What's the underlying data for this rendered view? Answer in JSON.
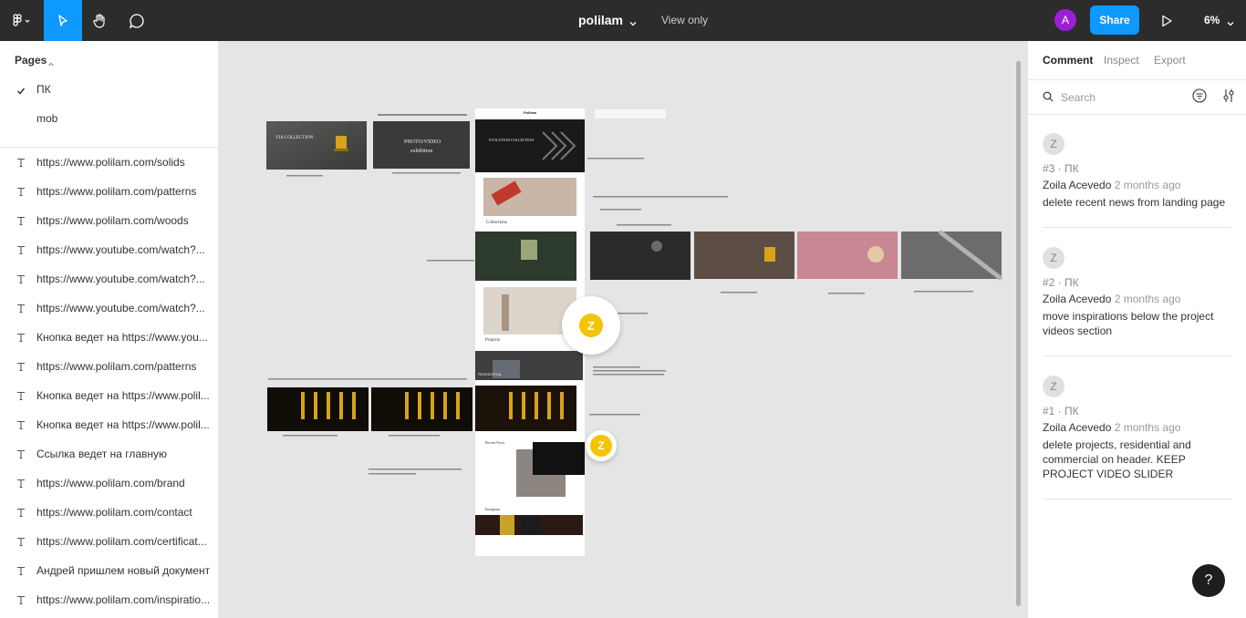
{
  "toolbar": {
    "file_name": "polilam",
    "view_mode": "View only",
    "user_initial": "A",
    "share_label": "Share",
    "zoom_level": "6%",
    "icons": [
      "figma-logo-icon",
      "move-tool-icon",
      "hand-tool-icon",
      "comment-tool-icon",
      "present-play-icon"
    ],
    "accent_color": "#0d99ff",
    "avatar_color": "#9b1fd6"
  },
  "left_panel": {
    "pages_header": "Pages",
    "pages": [
      {
        "label": "ПК",
        "selected": true
      },
      {
        "label": "mob",
        "selected": false
      }
    ],
    "layers": [
      "https://www.polilam.com/solids",
      "https://www.polilam.com/patterns",
      "https://www.polilam.com/woods",
      "https://www.youtube.com/watch?...",
      "https://www.youtube.com/watch?...",
      "https://www.youtube.com/watch?...",
      "Кнопка ведет на https://www.you...",
      "https://www.polilam.com/patterns",
      "Кнопка ведет на https://www.polil...",
      "Кнопка ведет на https://www.polil...",
      "Ссылка ведет на главную",
      "https://www.polilam.com/brand",
      "https://www.polilam.com/contact",
      "https://www.polilam.com/certificat...",
      "Андрей пришлем новый документ",
      "https://www.polilam.com/inspiratio..."
    ]
  },
  "canvas": {
    "pins": [
      {
        "initial": "Z",
        "color": "#f5c400"
      },
      {
        "initial": "Z",
        "color": "#f5c400"
      }
    ],
    "frame_texts": {
      "stone": "VIA COLLECTION",
      "photo": "PHOTO/VIDEO",
      "photo_sub": "exhibition",
      "evolution": "EVOLUTION COLLECTION",
      "collections": "Collections",
      "projects": "Projects",
      "residential": "RESIDENTIAL",
      "recent": "Recent News",
      "instagram": "Instagram",
      "logo": "Polilam"
    }
  },
  "right_panel": {
    "tabs": [
      {
        "label": "Comment",
        "active": true
      },
      {
        "label": "Inspect",
        "active": false
      },
      {
        "label": "Export",
        "active": false
      }
    ],
    "search_placeholder": "Search",
    "comments": [
      {
        "avatar": "Z",
        "meta": "#3 · ПК",
        "author": "Zoila Acevedo",
        "time": "2 months ago",
        "text": "delete recent news from landing page"
      },
      {
        "avatar": "Z",
        "meta": "#2 · ПК",
        "author": "Zoila Acevedo",
        "time": "2 months ago",
        "text": "move inspirations below the project videos section"
      },
      {
        "avatar": "Z",
        "meta": "#1 · ПК",
        "author": "Zoila Acevedo",
        "time": "2 months ago",
        "text": "delete projects, residential and commercial on header. KEEP PROJECT VIDEO SLIDER"
      }
    ],
    "help_label": "?"
  }
}
